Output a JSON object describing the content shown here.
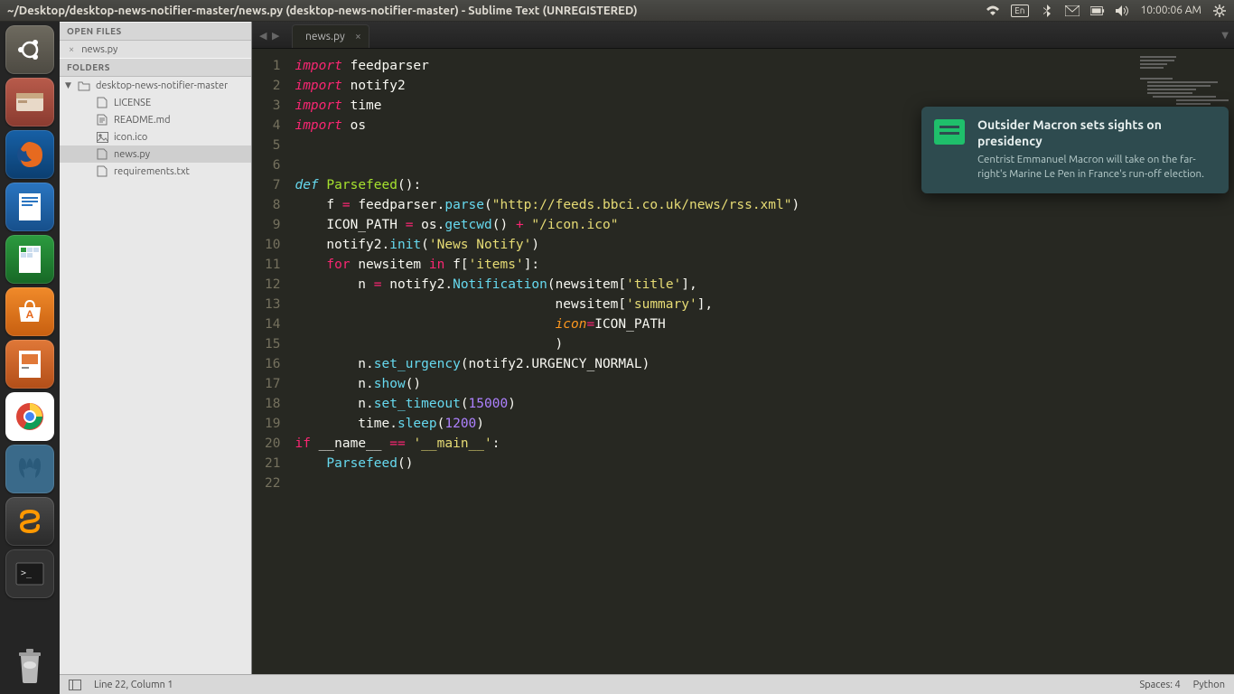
{
  "menubar": {
    "title": "~/Desktop/desktop-news-notifier-master/news.py (desktop-news-notifier-master) - Sublime Text (UNREGISTERED)",
    "keyboard": "En",
    "time": "10:00:06 AM"
  },
  "launcher": {
    "items": [
      "ubuntu",
      "files",
      "firefox",
      "writer",
      "calc",
      "software",
      "impress",
      "chrome",
      "postgres",
      "sublime",
      "terminal"
    ]
  },
  "sidebar": {
    "open_files_header": "OPEN FILES",
    "open_file": "news.py",
    "folders_header": "FOLDERS",
    "root": "desktop-news-notifier-master",
    "files": [
      {
        "name": "LICENSE",
        "icon": "file"
      },
      {
        "name": "README.md",
        "icon": "md"
      },
      {
        "name": "icon.ico",
        "icon": "image"
      },
      {
        "name": "news.py",
        "icon": "file",
        "active": true
      },
      {
        "name": "requirements.txt",
        "icon": "file"
      }
    ]
  },
  "tabs": {
    "active": "news.py"
  },
  "code": {
    "lines": [
      1,
      2,
      3,
      4,
      5,
      6,
      7,
      8,
      9,
      10,
      11,
      12,
      13,
      14,
      15,
      16,
      17,
      18,
      19,
      20,
      21,
      22
    ]
  },
  "statusbar": {
    "position": "Line 22, Column 1",
    "spaces": "Spaces: 4",
    "language": "Python"
  },
  "notification": {
    "title": "Outsider Macron sets sights on presidency",
    "body": "Centrist Emmanuel Macron will take on the far-right's Marine Le Pen in France's run-off election."
  }
}
